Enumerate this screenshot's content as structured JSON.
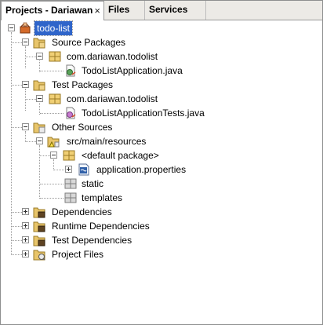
{
  "tabs": [
    {
      "label": "Projects - Dariawan",
      "close": "×",
      "active": true
    },
    {
      "label": "Files",
      "active": false
    },
    {
      "label": "Services",
      "active": false
    }
  ],
  "tree": {
    "project": "todo-list",
    "source_packages": "Source Packages",
    "source_pkg": "com.dariawan.todolist",
    "source_file": "TodoListApplication.java",
    "test_packages": "Test Packages",
    "test_pkg": "com.dariawan.todolist",
    "test_file": "TodoListApplicationTests.java",
    "other_sources": "Other Sources",
    "resources_dir": "src/main/resources",
    "default_pkg": "<default package>",
    "app_props": "application.properties",
    "static_dir": "static",
    "templates_dir": "templates",
    "dependencies": "Dependencies",
    "runtime_dependencies": "Runtime Dependencies",
    "test_dependencies": "Test Dependencies",
    "project_files": "Project Files"
  },
  "icons": {
    "project": "maven-project-icon",
    "package_folder": "package-folder-icon",
    "package": "package-icon",
    "java_file": "java-class-icon",
    "test_file": "java-test-class-icon",
    "resources_folder": "resources-folder-icon",
    "properties_file": "properties-file-icon",
    "empty_package": "empty-package-icon",
    "library_jars": "library-jar-icon"
  }
}
